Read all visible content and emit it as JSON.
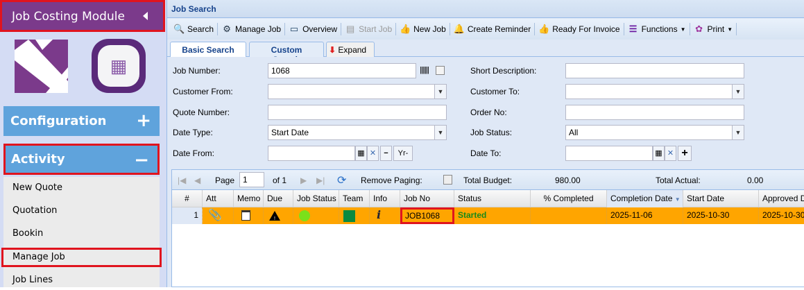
{
  "sidebar": {
    "module_title": "Job Costing Module",
    "sections": [
      {
        "label": "Configuration",
        "symbol": "+"
      },
      {
        "label": "Activity",
        "symbol": "−"
      }
    ],
    "items": [
      {
        "label": "New Quote"
      },
      {
        "label": "Quotation"
      },
      {
        "label": "Bookin"
      },
      {
        "label": "Manage Job"
      },
      {
        "label": "Job Lines"
      }
    ]
  },
  "panel": {
    "title": "Job Search"
  },
  "toolbar": [
    {
      "label": "Search",
      "icon": "magnifier-icon"
    },
    {
      "label": "Manage Job",
      "icon": "people-gear-icon"
    },
    {
      "label": "Overview",
      "icon": "overview-icon"
    },
    {
      "label": "Start Job",
      "icon": "calendar-check-icon",
      "disabled": true
    },
    {
      "label": "New Job",
      "icon": "thumbs-up-red-icon"
    },
    {
      "label": "Create Reminder",
      "icon": "bell-icon"
    },
    {
      "label": "Ready For Invoice",
      "icon": "thumbs-up-blue-icon"
    },
    {
      "label": "Functions",
      "icon": "menu-bars-icon"
    },
    {
      "label": "Print",
      "icon": "print-icon"
    }
  ],
  "tabs": {
    "basic": "Basic Search",
    "custom": "Custom Search",
    "expand": "Expand"
  },
  "form": {
    "job_number": {
      "label": "Job Number:",
      "value": "1068"
    },
    "short_description": {
      "label": "Short Description:",
      "value": ""
    },
    "customer_from": {
      "label": "Customer From:",
      "value": ""
    },
    "customer_to": {
      "label": "Customer To:",
      "value": ""
    },
    "quote_number": {
      "label": "Quote Number:",
      "value": ""
    },
    "order_no": {
      "label": "Order No:",
      "value": ""
    },
    "date_type": {
      "label": "Date Type:",
      "value": "Start Date"
    },
    "job_status": {
      "label": "Job Status:",
      "value": "All"
    },
    "date_from": {
      "label": "Date From:",
      "value": "",
      "yr": "Yr-"
    },
    "date_to": {
      "label": "Date To:",
      "value": ""
    }
  },
  "paging": {
    "page_label": "Page",
    "page": "1",
    "of": "of 1",
    "remove_paging": "Remove Paging:",
    "total_budget_label": "Total Budget:",
    "total_budget": "980.00",
    "total_actual_label": "Total Actual:",
    "total_actual": "0.00"
  },
  "columns": [
    "#",
    "Att",
    "Memo",
    "Due",
    "Job Status",
    "Team",
    "Info",
    "Job No",
    "Status",
    "% Completed",
    "Completion Date",
    "Start Date",
    "Approved D"
  ],
  "rows": [
    {
      "num": "1",
      "job_no": "JOB1068",
      "status": "Started",
      "pct": "",
      "completion_date": "2025-11-06",
      "start_date": "2025-10-30",
      "approved_date": "2025-10-30"
    }
  ],
  "colors": {
    "module": "#7b3a8b",
    "section": "#5fa3dc",
    "row_highlight": "#ffa500",
    "status_started": "#1a8a1a",
    "job_status_dot": "#7be01a",
    "team": "#0a8a40",
    "highlight_box": "#e0141e"
  }
}
